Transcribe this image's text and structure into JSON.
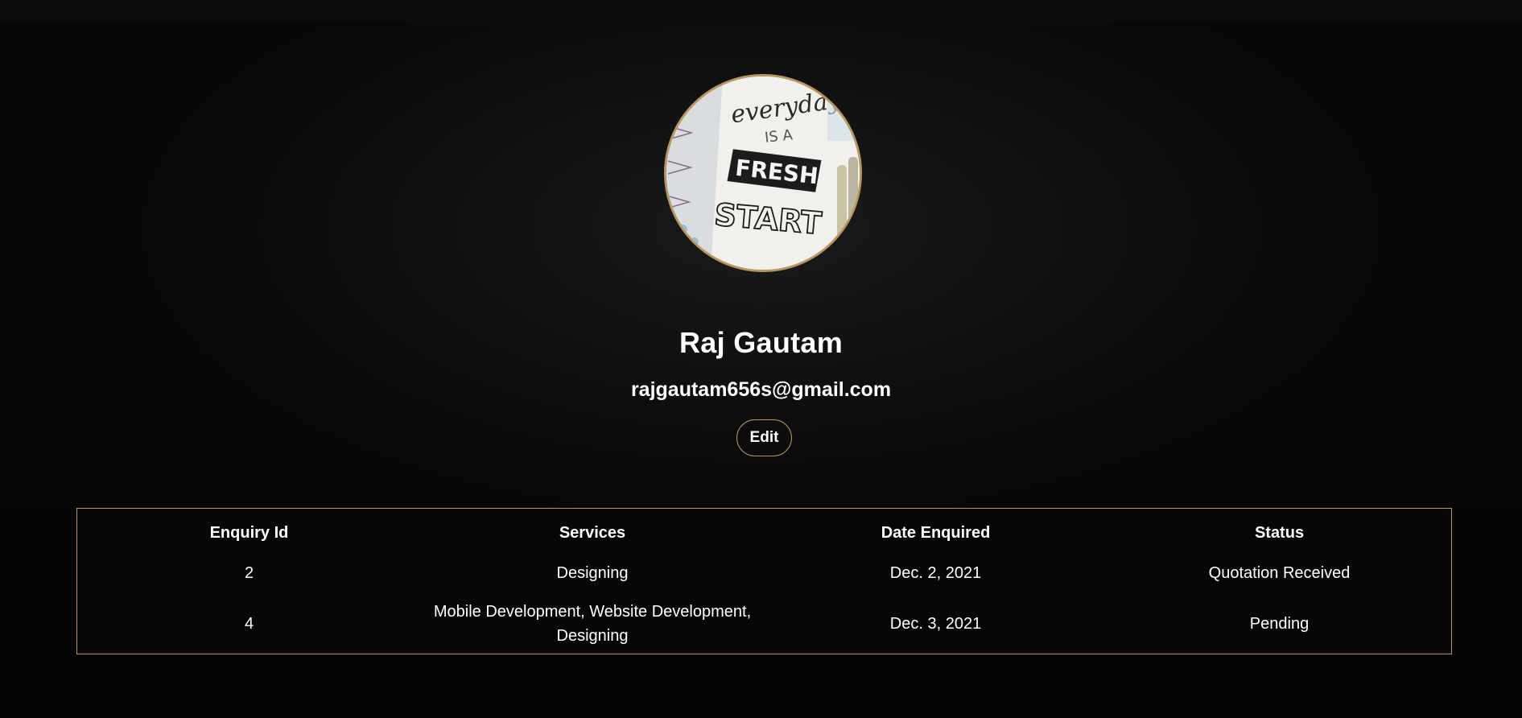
{
  "profile": {
    "name": "Raj Gautam",
    "email": "rajgautam656s@gmail.com",
    "edit_label": "Edit",
    "avatar_text": [
      "everyday",
      "IS A",
      "FRESH",
      "START"
    ]
  },
  "enquiries": {
    "columns": [
      "Enquiry Id",
      "Services",
      "Date Enquired",
      "Status"
    ],
    "rows": [
      {
        "id": "2",
        "services": "Designing",
        "date": "Dec. 2, 2021",
        "status": "Quotation Received"
      },
      {
        "id": "4",
        "services": "Mobile Development, Website Development, Designing",
        "date": "Dec. 3, 2021",
        "status": "Pending"
      }
    ]
  },
  "colors": {
    "accent": "#b8965f",
    "background": "#050505",
    "text": "#ffffff"
  }
}
